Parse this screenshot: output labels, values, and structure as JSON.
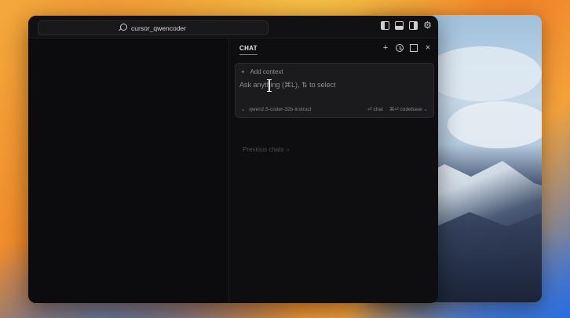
{
  "titlebar": {
    "search_text": "cursor_qwencoder",
    "icons": [
      "toggle-left-panel-icon",
      "toggle-bottom-panel-icon",
      "toggle-right-panel-icon",
      "gear-icon"
    ]
  },
  "chat": {
    "tab_label": "CHAT",
    "actions": [
      "plus-icon",
      "history-icon",
      "maximize-icon",
      "close-icon"
    ],
    "add_context_label": "Add context",
    "input_placeholder": "Ask anything (⌘L), ⇅ to select",
    "model_label": "qwen2.5-coder-32b-instruct",
    "chat_hint": "⏎ chat",
    "codebase_hint": "⌘⏎ codebase ⌄",
    "previous_chats_label": "Previous chats",
    "previous_chats_arrow": "›"
  },
  "glyphs": {
    "plus": "+",
    "close": "×",
    "gear": "⚙",
    "chevron_down": "⌄"
  },
  "colors": {
    "accent": "#3b82f6",
    "window_bg": "#0d0d0f",
    "panel_bg": "#1b1b1e"
  }
}
